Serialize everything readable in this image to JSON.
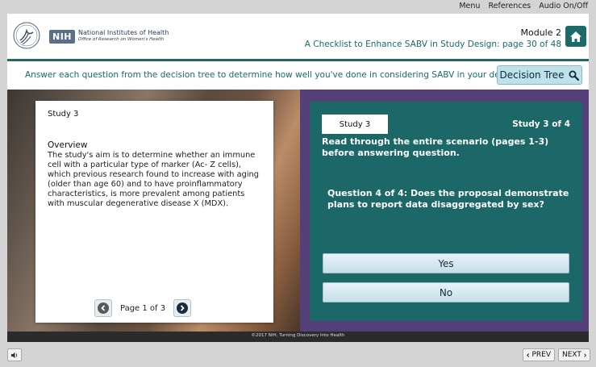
{
  "top_menu": {
    "items": [
      "Menu",
      "References",
      "Audio On/Off"
    ]
  },
  "header": {
    "logo_badge": "NIH",
    "logo_line1": "National Institutes of Health",
    "logo_line2": "Office of Research on Women's Health",
    "module_title": "Module 2",
    "module_subtitle": "A Checklist to Enhance SABV in Study Design: page 30 of 48",
    "home_icon": "home-icon"
  },
  "instruction": {
    "text": "Answer each question from the decision tree to determine how well you've done in considering SABV in your design.",
    "decision_tree_label": "Decision Tree",
    "decision_tree_icon": "search-icon"
  },
  "study_card": {
    "title": "Study 3",
    "overview_heading": "Overview",
    "overview_body": "The study's aim is to determine whether an immune cell with a particular type of marker (Ac- Z cells), which previous research found to increase with aging (older than age 60) and to have proinflammatory characteristics, is more prevalent among patients with muscular degenerative disease X (MDX).",
    "pager_label": "Page 1 of 3"
  },
  "question_panel": {
    "tag": "Study 3",
    "counter": "Study 3  of  4",
    "instruction": "Read through the entire scenario (pages 1-3) before answering question.",
    "question": "Question 4 of 4: Does the proposal demonstrate plans to report data disaggregated by sex?",
    "answers": [
      "Yes",
      "No"
    ]
  },
  "footer": {
    "copyright": "©2017 NIH, Turning Discovery Into Health"
  },
  "bottom_nav": {
    "prev_label": "PREV",
    "next_label": "NEXT"
  },
  "colors": {
    "teal": "#1c6767",
    "purple": "#553f79",
    "accent_text": "#1b6a6a"
  }
}
